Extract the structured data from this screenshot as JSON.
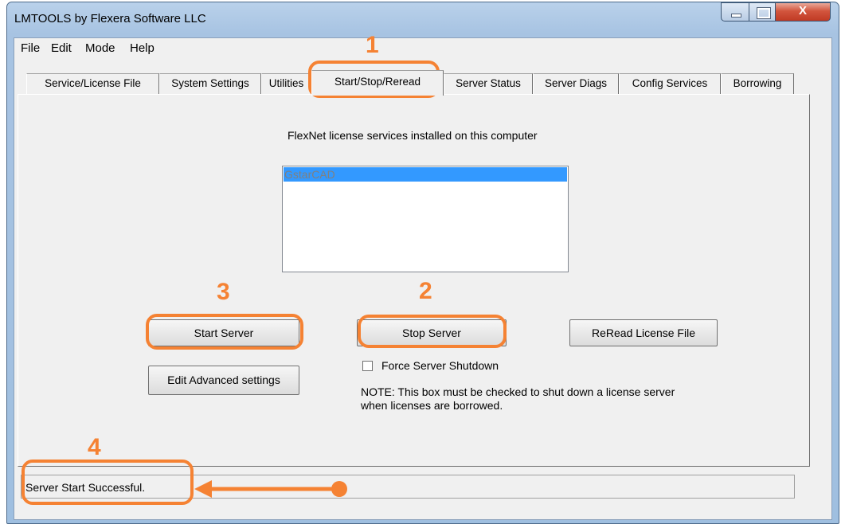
{
  "window": {
    "title": "LMTOOLS by Flexera Software LLC",
    "close_glyph": "X"
  },
  "menu": [
    "File",
    "Edit",
    "Mode",
    "Help"
  ],
  "tabs": [
    "Service/License File",
    "System Settings",
    "Utilities",
    "Start/Stop/Reread",
    "Server Status",
    "Server Diags",
    "Config Services",
    "Borrowing"
  ],
  "active_tab": "Start/Stop/Reread",
  "panel": {
    "services_label": "FlexNet license services installed on this computer",
    "services": [
      "GstarCAD"
    ],
    "start_button": "Start Server",
    "stop_button": "Stop Server",
    "reread_button": "ReRead License File",
    "advanced_button": "Edit Advanced settings",
    "force_shutdown_label": "Force Server Shutdown",
    "force_shutdown_checked": false,
    "note_line1": "NOTE:  This box must be checked to shut down a license server",
    "note_line2": "when licenses are borrowed."
  },
  "status": {
    "text": "Server Start Successful."
  },
  "annotations": {
    "color": "#f58233",
    "step1": "1",
    "step2": "2",
    "step3": "3",
    "step4": "4"
  }
}
